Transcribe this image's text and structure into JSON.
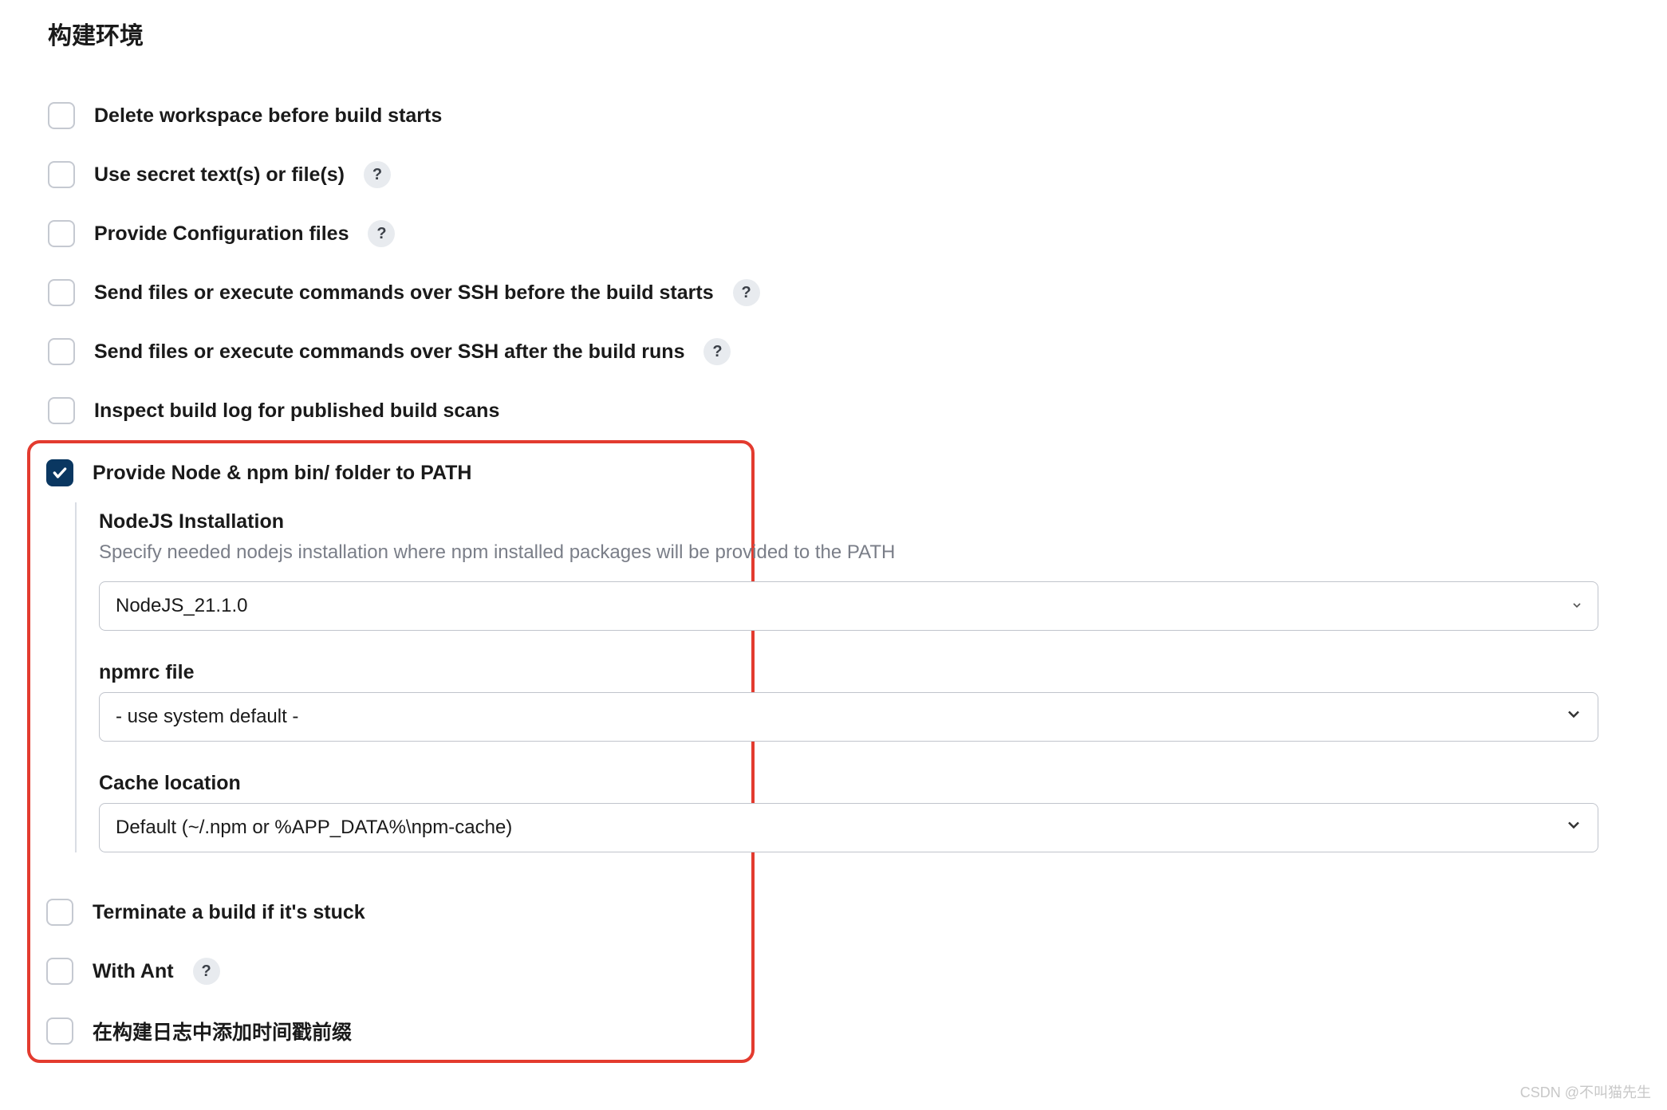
{
  "section_title": "构建环境",
  "options": {
    "delete_workspace": "Delete workspace before build starts",
    "use_secret": "Use secret text(s) or file(s)",
    "provide_config": "Provide Configuration files",
    "ssh_before": "Send files or execute commands over SSH before the build starts",
    "ssh_after": "Send files or execute commands over SSH after the build runs",
    "inspect_log": "Inspect build log for published build scans",
    "provide_node": "Provide Node & npm bin/ folder to PATH",
    "terminate_stuck": "Terminate a build if it's stuck",
    "with_ant": "With Ant",
    "timestamp_prefix": "在构建日志中添加时间戳前缀"
  },
  "node_section": {
    "install_label": "NodeJS Installation",
    "install_desc": "Specify needed nodejs installation where npm installed packages will be provided to the PATH",
    "install_value": "NodeJS_21.1.0",
    "npmrc_label": "npmrc file",
    "npmrc_value": "- use system default -",
    "cache_label": "Cache location",
    "cache_value": "Default (~/.npm or %APP_DATA%\\npm-cache)"
  },
  "help_symbol": "?",
  "watermark": "CSDN @不叫猫先生"
}
